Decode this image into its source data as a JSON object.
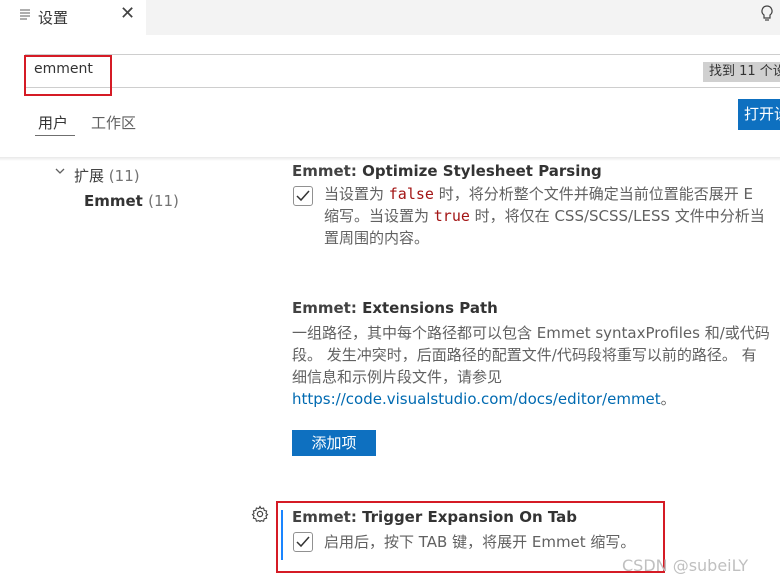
{
  "tab": {
    "title": "设置",
    "close": "✕"
  },
  "search": {
    "value": "emment",
    "found": "找到 11 个设"
  },
  "scopes": {
    "user": "用户",
    "workspace": "工作区",
    "open_button": "打开设"
  },
  "toc": {
    "extensions_label": "扩展",
    "extensions_count": "(11)",
    "emmet_label": "Emmet",
    "emmet_count": "(11)"
  },
  "settings": [
    {
      "category": "Emmet: ",
      "name": "Optimize Stylesheet Parsing",
      "checked": true,
      "desc1": "当设置为 ",
      "code1": "false",
      "desc2": " 时，将分析整个文件并确定当前位置能否展开 E",
      "desc3": "缩写。当设置为 ",
      "code2": "true",
      "desc4": " 时，将仅在 CSS/SCSS/LESS 文件中分析当",
      "desc5": "置周围的内容。"
    },
    {
      "category": "Emmet: ",
      "name": "Extensions Path",
      "line1": "一组路径，其中每个路径都可以包含 Emmet syntaxProfiles 和/或代码",
      "line2": "段。 发生冲突时，后面路径的配置文件/代码段将重写以前的路径。 有",
      "line3": "细信息和示例片段文件，请参见",
      "link": "https://code.visualstudio.com/docs/editor/emmet",
      "link_suffix": "。",
      "button": "添加项"
    },
    {
      "category": "Emmet: ",
      "name": "Trigger Expansion On Tab",
      "checked": true,
      "desc": "启用后，按下 TAB 键，将展开 Emmet 缩写。"
    }
  ],
  "watermark": "CSDN @subeiLY",
  "icons": [
    "settings-file-icon",
    "close-icon",
    "lightbulb-icon",
    "chevron-down-icon",
    "checkmark-icon",
    "gear-icon"
  ],
  "colors": {
    "accent": "#0e70c0",
    "highlight_box": "#d51b25",
    "modified_indicator": "#1a85ff",
    "link": "#006ab1",
    "code": "#a31515"
  }
}
